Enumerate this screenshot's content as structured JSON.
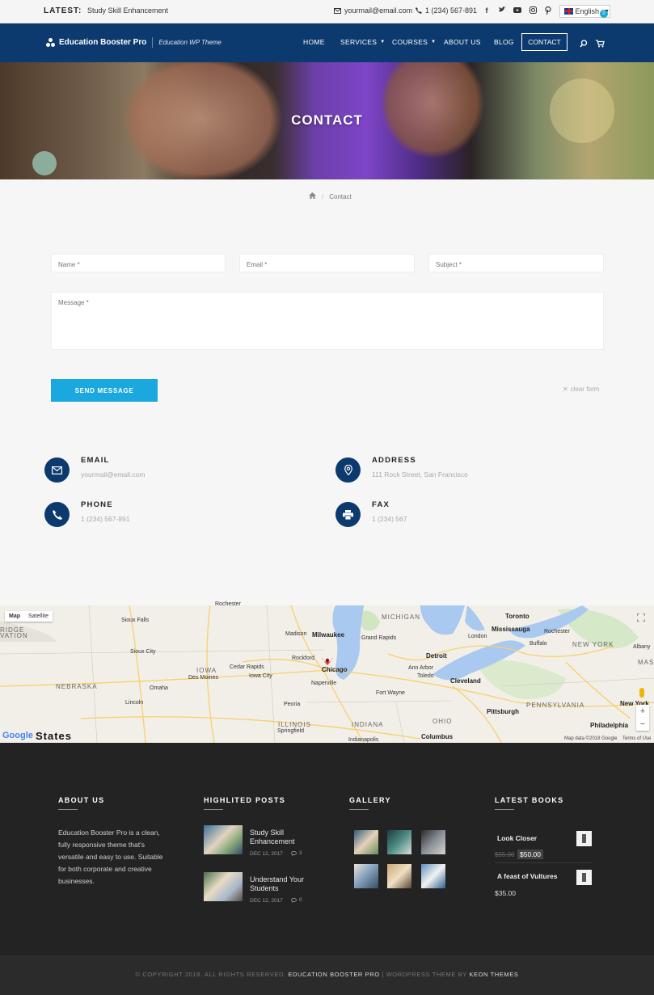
{
  "topbar": {
    "latest_label": "LATEST:",
    "latest_text": "Study Skill Enhancement",
    "email": "yourmail@email.com",
    "phone": "1 (234) 567-891",
    "socials": [
      "facebook-icon",
      "twitter-icon",
      "youtube-icon",
      "instagram-icon",
      "pinterest-icon"
    ],
    "language": "English"
  },
  "nav": {
    "brand": "Education Booster Pro",
    "tagline": "Education WP Theme",
    "items": [
      "HOME",
      "SERVICES",
      "COURSES",
      "ABOUT US",
      "BLOG",
      "CONTACT"
    ],
    "cart_count": "0"
  },
  "hero": {
    "title": "CONTACT"
  },
  "breadcrumb": {
    "current": "Contact"
  },
  "form": {
    "name_placeholder": "Name *",
    "email_placeholder": "Email *",
    "subject_placeholder": "Subject *",
    "message_placeholder": "Message *",
    "send_label": "SEND MESSAGE",
    "clear_label": "clear form"
  },
  "info": {
    "email_title": "EMAIL",
    "email_value": "yourmail@email.com",
    "address_title": "ADDRESS",
    "address_value": "111 Rock Street, San Francisco",
    "phone_title": "PHONE",
    "phone_value": "1 (234) 567-891",
    "fax_title": "FAX",
    "fax_value": "1 (234) 567"
  },
  "map": {
    "map_btn": "Map",
    "satellite_btn": "Satellite",
    "labels": [
      "Rochester",
      "Sioux Falls",
      "MICHIGAN",
      "Toronto",
      "Mississauga",
      "Rochester",
      "Milwaukee",
      "Madison",
      "Grand Rapids",
      "London",
      "Buffalo",
      "NEW YORK",
      "Albany",
      "Sioux City",
      "Rockford",
      "Chicago",
      "Detroit",
      "Cedar Rapids",
      "IOWA",
      "Des Moines",
      "Iowa City",
      "Ann Arbor",
      "Toledo",
      "Cleveland",
      "MAS",
      "NEBRASKA",
      "Naperville",
      "Fort Wayne",
      "Lincoln",
      "Omaha",
      "Peoria",
      "PENNSYLVANIA",
      "New York",
      "Pittsburgh",
      "ILLINOIS",
      "Springfield",
      "INDIANA",
      "OHIO",
      "Philadelphia",
      "Columbus",
      "Indianapolis",
      "RIDGE",
      "VATION"
    ],
    "states_label": "States",
    "google": "Google",
    "map_data": "Map data ©2018 Google",
    "terms": "Terms of Use"
  },
  "footer": {
    "about_title": "ABOUT US",
    "about_text": "Education Booster Pro is a clean, fully responsive theme that's versatile and easy to use. Suitable for both corporate and creative businesses.",
    "posts_title": "HIGHLITED POSTS",
    "posts": [
      {
        "title": "Study Skill Enhancement",
        "date": "DEC 12, 2017",
        "comments": "3"
      },
      {
        "title": "Understand Your Students",
        "date": "DEC 12, 2017",
        "comments": "0"
      }
    ],
    "gallery_title": "GALLERY",
    "books_title": "LATEST BOOKS",
    "books": [
      {
        "title": "Look Closer",
        "old_price": "$55.00",
        "price": "$50.00"
      },
      {
        "title": "A feast of Vultures",
        "price": "$35.00"
      }
    ]
  },
  "bottom": {
    "copyright": "© COPYRIGHT 2018. ALL RIGHTS RESERVED.",
    "brand": "EDUCATION BOOSTER PRO",
    "mid": "| WORDPRESS THEME BY",
    "author": "KEON THEMES"
  }
}
